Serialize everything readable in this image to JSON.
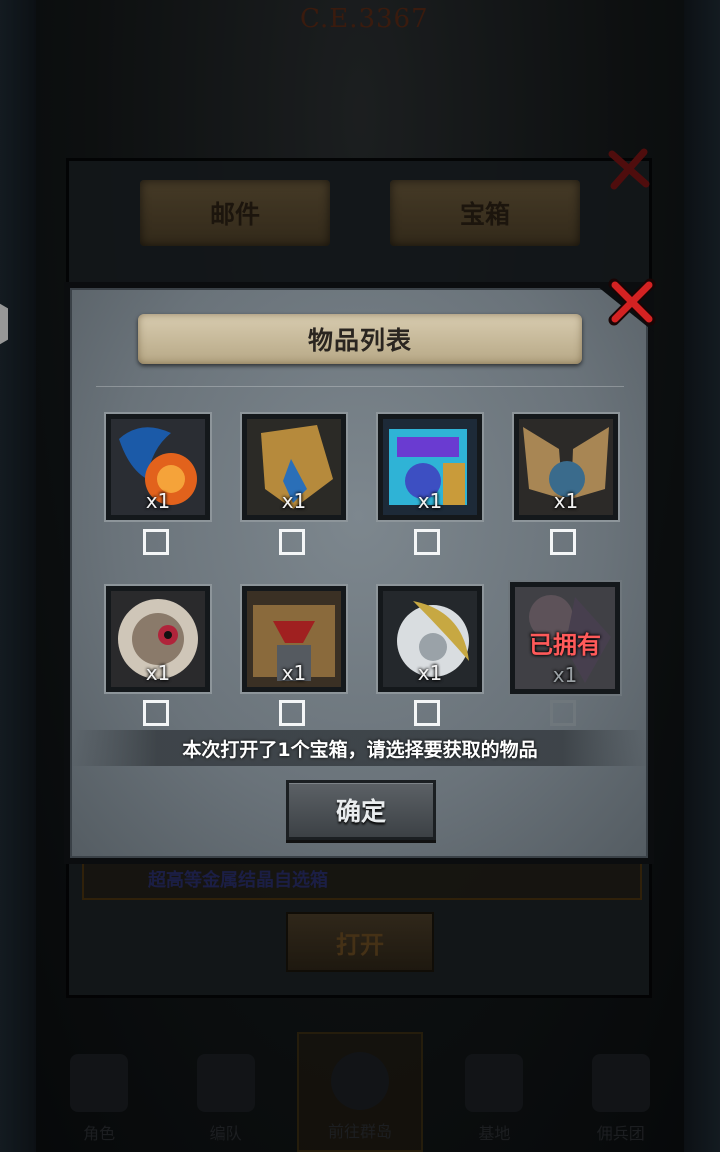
{
  "background": {
    "era_text": "C.E.3367",
    "tabs": [
      "邮件",
      "宝箱"
    ],
    "open_button": "打开",
    "mail_row_text": "超高等金属结晶自选箱"
  },
  "bottom_nav": {
    "items": [
      "角色",
      "编队",
      "前往群岛",
      "基地",
      "佣兵团"
    ]
  },
  "dialog": {
    "title": "物品列表",
    "items": [
      {
        "name": "flame-wing-item",
        "qty": "x1",
        "owned": false,
        "colors": [
          "#1b5aa8",
          "#e2621c"
        ]
      },
      {
        "name": "golden-shield-item",
        "qty": "x1",
        "owned": false,
        "colors": [
          "#b68a3c",
          "#2a6fb8"
        ]
      },
      {
        "name": "crystal-box-item",
        "qty": "x1",
        "owned": false,
        "colors": [
          "#2fb3d6",
          "#6a3bd1"
        ]
      },
      {
        "name": "winged-armor-item",
        "qty": "x1",
        "owned": false,
        "colors": [
          "#a88654",
          "#3a6b8c"
        ]
      },
      {
        "name": "eye-disc-item",
        "qty": "x1",
        "owned": false,
        "colors": [
          "#cfc6b8",
          "#b0243a"
        ]
      },
      {
        "name": "demon-mech-item",
        "qty": "x1",
        "owned": false,
        "colors": [
          "#8a6a3c",
          "#a02020"
        ]
      },
      {
        "name": "silver-blade-item",
        "qty": "x1",
        "owned": false,
        "colors": [
          "#c7a842",
          "#d9dde0"
        ]
      },
      {
        "name": "owned-item",
        "qty": "x1",
        "owned": true,
        "owned_label": "已拥有",
        "colors": [
          "#7a5a62",
          "#4a2f4a"
        ]
      }
    ],
    "info_text": "本次打开了1个宝箱，请选择要获取的物品",
    "confirm_label": "确定"
  }
}
